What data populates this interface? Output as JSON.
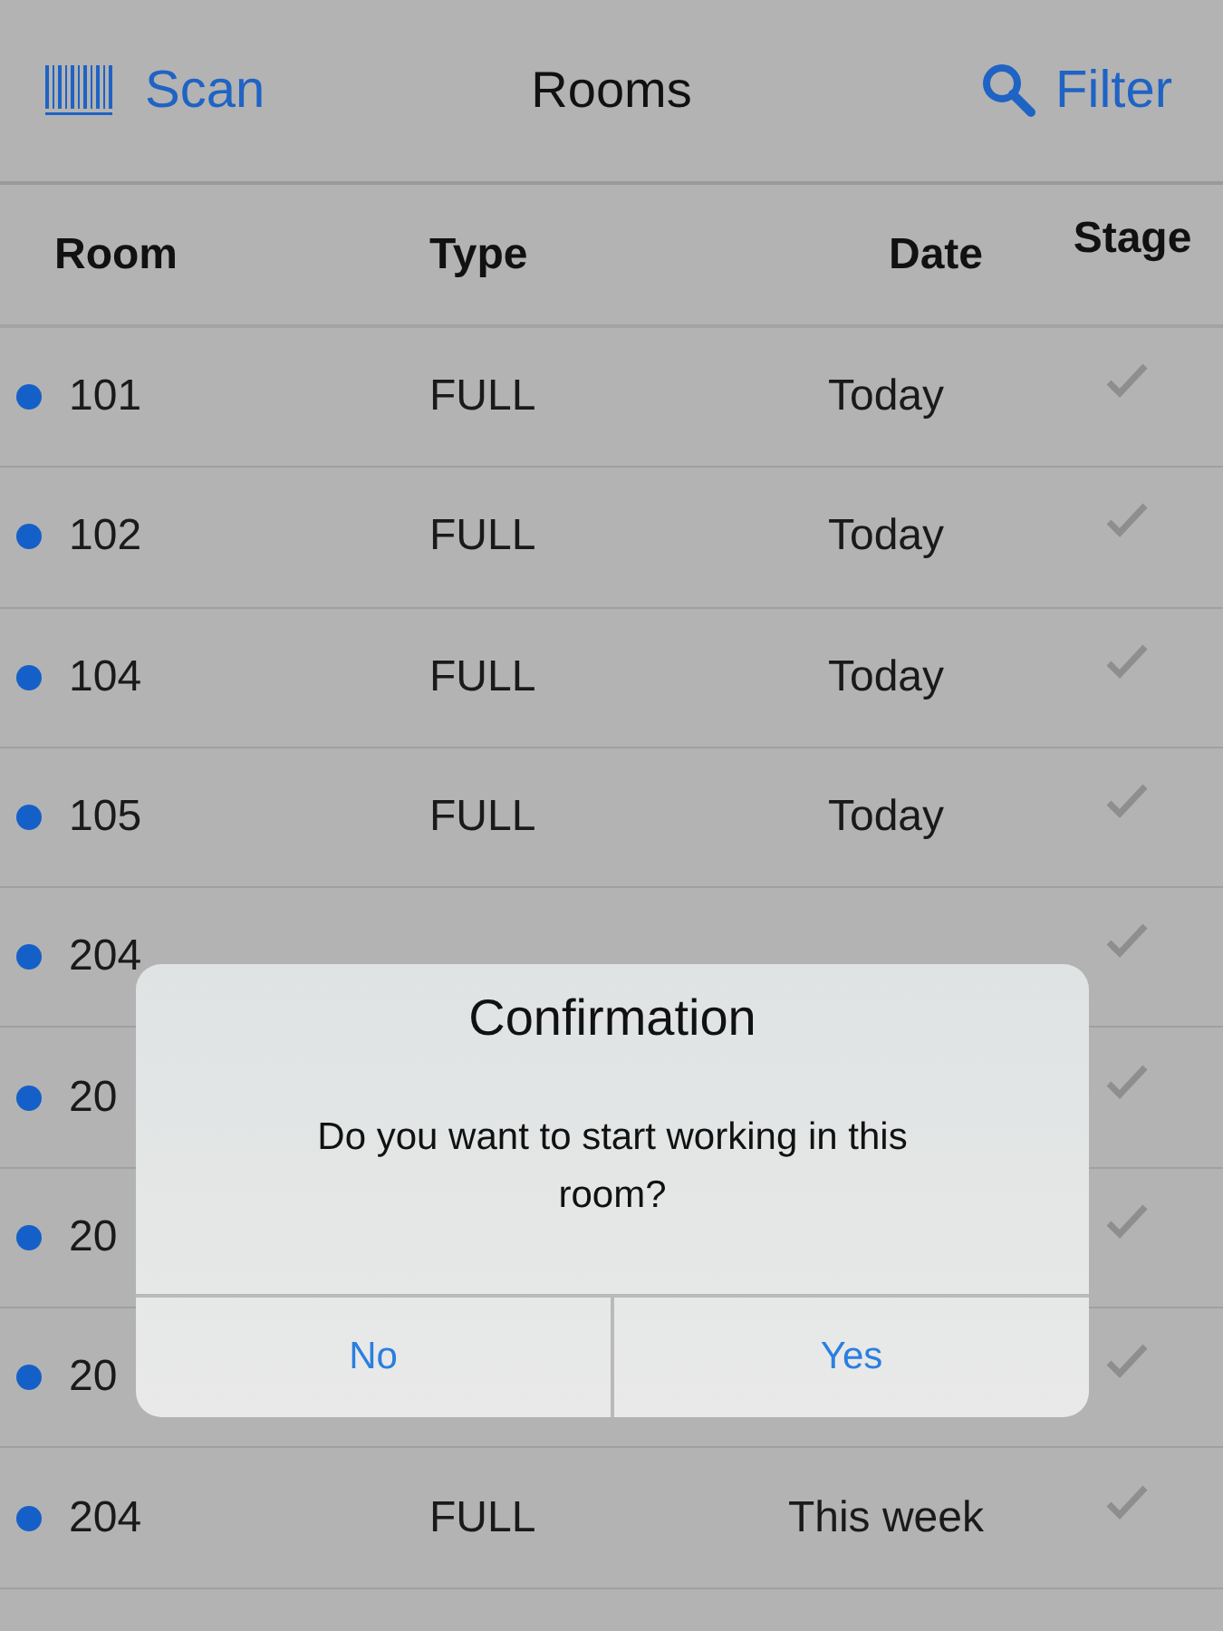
{
  "nav": {
    "scan": "Scan",
    "title": "Rooms",
    "filter": "Filter"
  },
  "columns": [
    "Room",
    "Type",
    "Date",
    "Stage"
  ],
  "rows": [
    {
      "room": "101",
      "type": "FULL",
      "date": "Today",
      "unread": true,
      "checked": true
    },
    {
      "room": "102",
      "type": "FULL",
      "date": "Today",
      "unread": true,
      "checked": true
    },
    {
      "room": "104",
      "type": "FULL",
      "date": "Today",
      "unread": true,
      "checked": true
    },
    {
      "room": "105",
      "type": "FULL",
      "date": "Today",
      "unread": true,
      "checked": true
    },
    {
      "room": "204",
      "unread": true,
      "checked": true
    },
    {
      "room": "20",
      "unread": true,
      "checked": true
    },
    {
      "room": "20",
      "unread": true,
      "checked": true
    },
    {
      "room": "20",
      "unread": true,
      "checked": true
    },
    {
      "room": "204",
      "type": "FULL",
      "date": "This week",
      "unread": true,
      "checked": true
    }
  ],
  "dialog": {
    "title": "Confirmation",
    "message": "Do you want to start working in this room?",
    "buttons": [
      "No",
      "Yes"
    ]
  }
}
